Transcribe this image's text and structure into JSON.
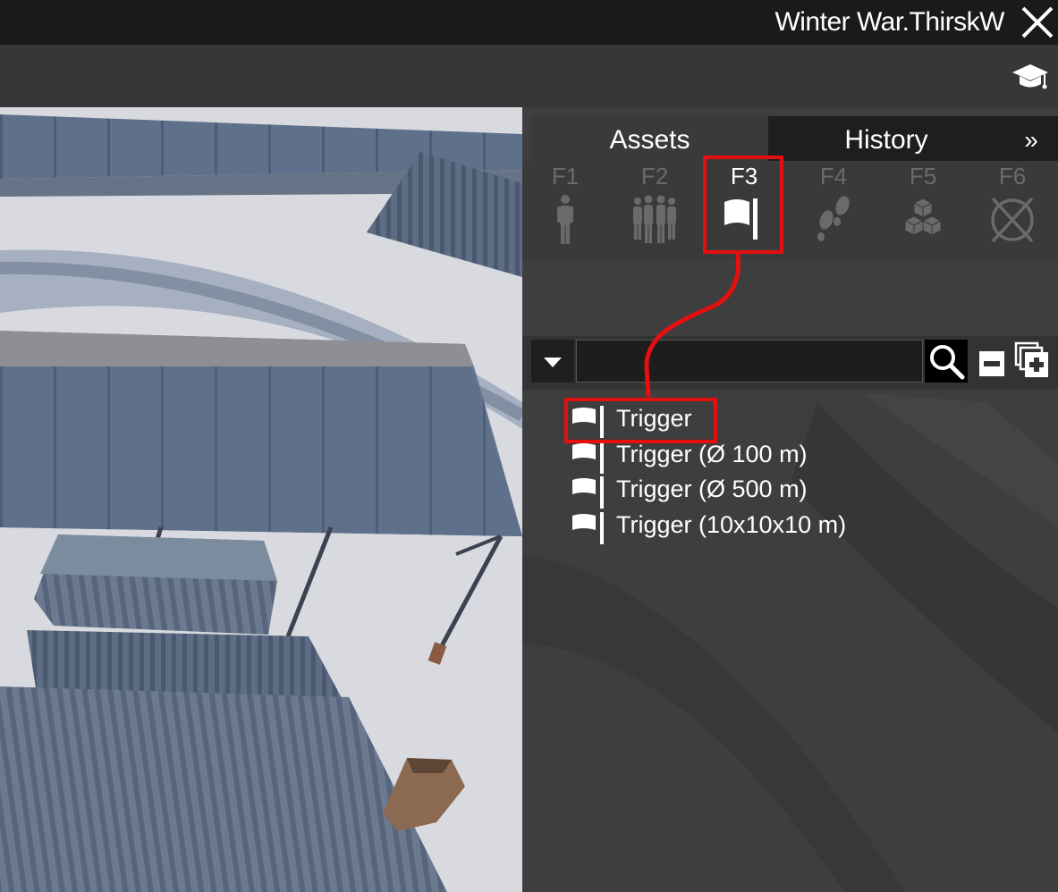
{
  "window": {
    "title": "Winter War.ThirskW",
    "close_icon": "close-icon"
  },
  "toolbar": {
    "tutorial_icon": "graduation-cap-icon"
  },
  "panel": {
    "tabs": [
      {
        "label": "Assets",
        "active": true
      },
      {
        "label": "History",
        "active": false
      },
      {
        "label": "»",
        "icon": "double-chevron-right-icon"
      }
    ],
    "categories": [
      {
        "key": "F1",
        "icon": "single-unit-icon",
        "active": false
      },
      {
        "key": "F2",
        "icon": "group-icon",
        "active": false
      },
      {
        "key": "F3",
        "icon": "flag-icon",
        "active": true
      },
      {
        "key": "F4",
        "icon": "footsteps-icon",
        "active": false
      },
      {
        "key": "F5",
        "icon": "boxes-icon",
        "active": false
      },
      {
        "key": "F6",
        "icon": "crossed-circle-icon",
        "active": false
      }
    ],
    "search": {
      "value": "",
      "placeholder": ""
    },
    "assets": [
      {
        "label": "Trigger",
        "icon": "flag-icon"
      },
      {
        "label": "Trigger (Ø 100 m)",
        "icon": "flag-icon"
      },
      {
        "label": "Trigger (Ø 500 m)",
        "icon": "flag-icon"
      },
      {
        "label": "Trigger (10x10x10 m)",
        "icon": "flag-icon"
      }
    ]
  },
  "colors": {
    "highlight": "#e41010",
    "panel_bg": "#3e3e3e",
    "titlebar_bg": "#1a1a1a",
    "inactive_icon": "#6a6a6a"
  }
}
